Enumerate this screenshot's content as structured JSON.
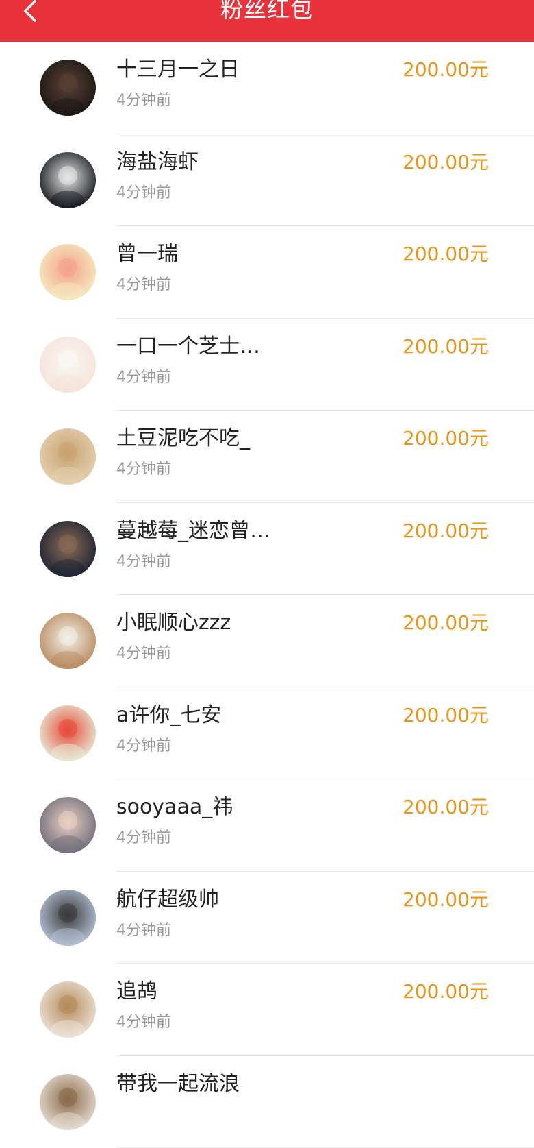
{
  "header": {
    "title": "粉丝红包",
    "background": "#e8323c"
  },
  "colors": {
    "amount": "#e8941a",
    "name": "#222222",
    "time": "#9a9a9a"
  },
  "items": [
    {
      "name": "十三月一之日",
      "time": "4分钟前",
      "amount": "200.00元",
      "avatar_colors": [
        "#1a1614",
        "#5a4034"
      ]
    },
    {
      "name": "海盐海虾",
      "time": "4分钟前",
      "amount": "200.00元",
      "avatar_colors": [
        "#0f1218",
        "#e8e8e8"
      ]
    },
    {
      "name": "曾一瑞",
      "time": "4分钟前",
      "amount": "200.00元",
      "avatar_colors": [
        "#f7ecc2",
        "#f2a38a"
      ]
    },
    {
      "name": "一口一个芝士…",
      "time": "4分钟前",
      "amount": "200.00元",
      "avatar_colors": [
        "#f6e3da",
        "#f9f7f2"
      ]
    },
    {
      "name": "土豆泥吃不吃_",
      "time": "4分钟前",
      "amount": "200.00元",
      "avatar_colors": [
        "#e4d2b2",
        "#c9a271"
      ]
    },
    {
      "name": "蔓越莓_迷恋曾…",
      "time": "4分钟前",
      "amount": "200.00元",
      "avatar_colors": [
        "#1b2234",
        "#8a6a55"
      ]
    },
    {
      "name": "小眠顺心zzz",
      "time": "4分钟前",
      "amount": "200.00元",
      "avatar_colors": [
        "#b7885b",
        "#f3efe8"
      ]
    },
    {
      "name": "a许你_七安",
      "time": "4分钟前",
      "amount": "200.00元",
      "avatar_colors": [
        "#e6f1dc",
        "#e84a3a"
      ]
    },
    {
      "name": "sooyaaa_祎",
      "time": "4分钟前",
      "amount": "200.00元",
      "avatar_colors": [
        "#6d6a78",
        "#e9cfc3"
      ]
    },
    {
      "name": "航仔超级帅",
      "time": "4分钟前",
      "amount": "200.00元",
      "avatar_colors": [
        "#b8c6da",
        "#3a3a3a"
      ]
    },
    {
      "name": "追鸪",
      "time": "4分钟前",
      "amount": "200.00元",
      "avatar_colors": [
        "#efe6dc",
        "#b48a5a"
      ]
    },
    {
      "name": "带我一起流浪",
      "time": "",
      "amount": "",
      "avatar_colors": [
        "#e8e0d6",
        "#8a6a4a"
      ]
    }
  ]
}
